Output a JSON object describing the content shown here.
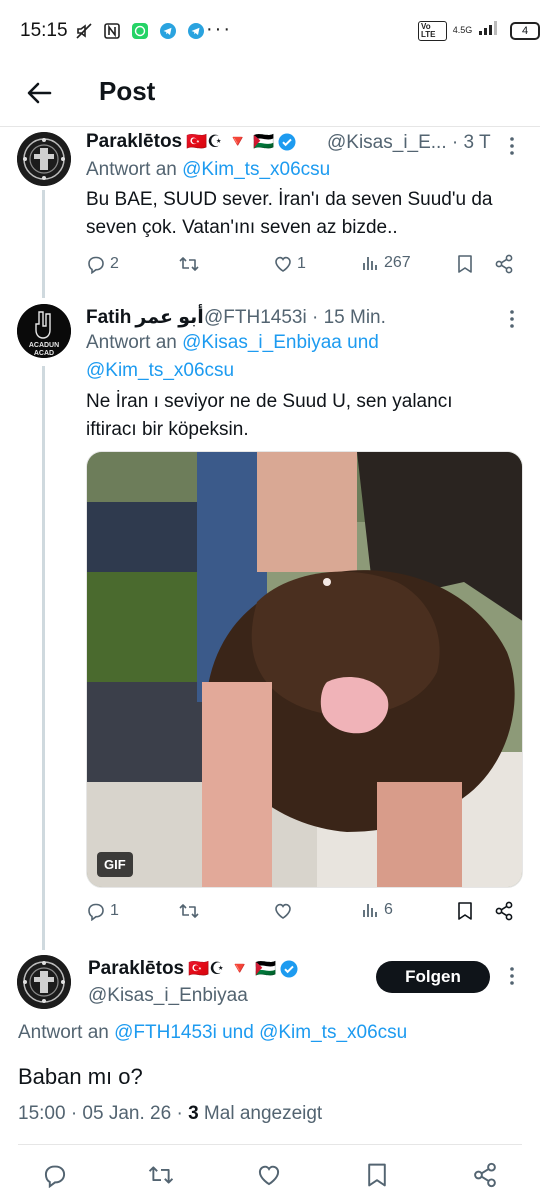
{
  "status_bar": {
    "time": "15:15",
    "dots": "···",
    "volte": "Vo LTE",
    "network": "4.5G",
    "battery": "4"
  },
  "header": {
    "title": "Post"
  },
  "tweets": [
    {
      "name": "Paraklētos",
      "flags": "🇹🇷☪ 🔻 🇵🇸",
      "handle_time": "@Kisas_i_E... · 3 T",
      "reply_prefix": "Antwort an ",
      "reply_to": "@Kim_ts_x06csu",
      "text": "Bu BAE, SUUD sever. İran'ı da seven Suud'u da seven çok. Vatan'ını seven az bizde..",
      "stats": {
        "replies": "2",
        "retweets": "",
        "likes": "1",
        "views": "267"
      }
    },
    {
      "name": "Fatih",
      "name_arabic": "أبو عمر",
      "handle_time": "@FTH1453i · 15 Min.",
      "avatar_text_top": "ACADUN",
      "avatar_text_bottom": "ACAD",
      "reply_prefix": "Antwort an ",
      "reply_to_1": "@Kisas_i_Enbiyaa",
      "reply_and": " und",
      "reply_to_2": "@Kim_ts_x06csu",
      "text": "Ne İran ı seviyor ne de Suud U, sen yalancı iftiracı bir köpeksin.",
      "gif_label": "GIF",
      "stats": {
        "replies": "1",
        "retweets": "",
        "likes": "",
        "views": "6"
      }
    }
  ],
  "main_post": {
    "name": "Paraklētos",
    "flags": "🇹🇷☪ 🔻 🇵🇸",
    "handle": "@Kisas_i_Enbiyaa",
    "follow_label": "Folgen",
    "reply_prefix": "Antwort an ",
    "reply_to_1": "@FTH1453i",
    "reply_and": " und ",
    "reply_to_2": "@Kim_ts_x06csu",
    "text": "Baban mı o?",
    "meta_prefix": "15:00 · 05 Jan. 26 · ",
    "meta_count": "3",
    "meta_suffix": " Mal angezeigt"
  },
  "colors": {
    "accent": "#1d9bf0",
    "secondary_text": "#536471",
    "primary_text": "#0f1419",
    "divider": "#e6e6e6"
  },
  "icons": [
    "back-arrow-icon",
    "verified-icon",
    "more-icon",
    "reply-icon",
    "retweet-icon",
    "like-icon",
    "views-icon",
    "bookmark-icon",
    "share-icon"
  ]
}
